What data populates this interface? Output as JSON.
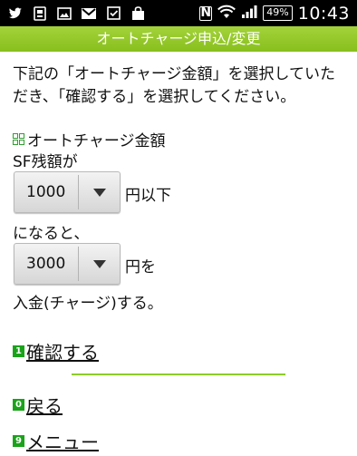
{
  "statusbar": {
    "left_icons": [
      "twitter-icon",
      "sim-icon",
      "image-icon",
      "gmail-icon",
      "checkbox-icon",
      "bag-icon"
    ],
    "nfc_label": "N",
    "battery": "49%",
    "time": "10:43"
  },
  "header": {
    "title": "オートチャージ申込/変更"
  },
  "intro": "下記の「オートチャージ金額」を選択していただき、「確認する」を選択してください。",
  "section": {
    "title": "オートチャージ金額"
  },
  "sf_label": "SF残額が",
  "threshold": {
    "value": "1000",
    "suffix": "円以下"
  },
  "naruto": "になると、",
  "amount": {
    "value": "3000",
    "suffix": "円を"
  },
  "deposit_text": "入金(チャージ)する。",
  "links": [
    {
      "num": "1",
      "label": "確認する"
    },
    {
      "num": "0",
      "label": "戻る"
    },
    {
      "num": "9",
      "label": "メニュー"
    }
  ],
  "colors": {
    "accent": "#8ccd2a",
    "badge": "#1aa31a"
  }
}
